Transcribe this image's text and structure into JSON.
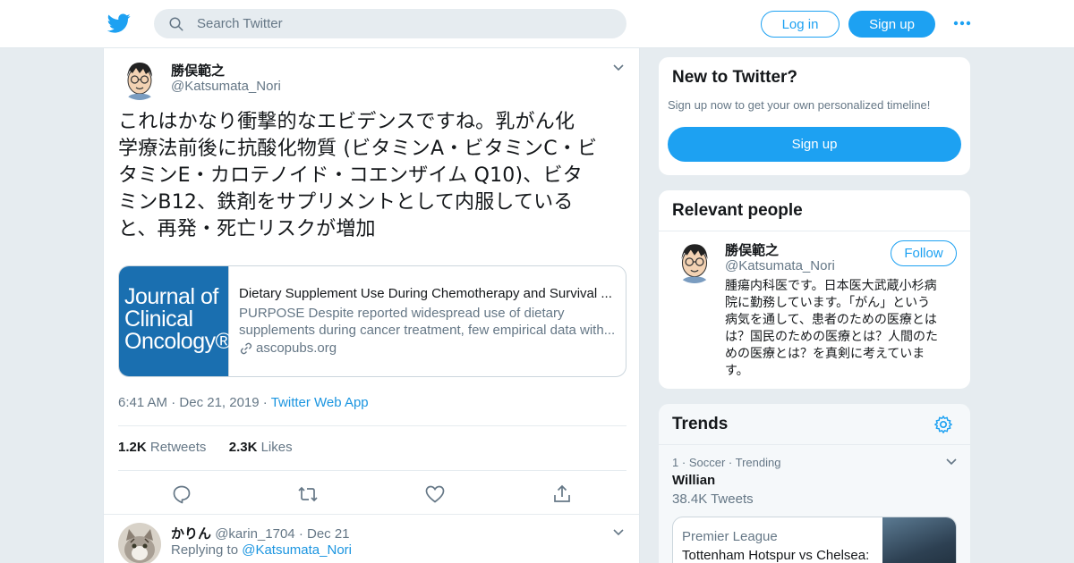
{
  "header": {
    "search_placeholder": "Search Twitter",
    "login_label": "Log in",
    "signup_label": "Sign up",
    "brand_color": "#1da1f2"
  },
  "tweet": {
    "name": "勝俣範之",
    "handle": "@Katsumata_Nori",
    "text_lines": [
      "これはかなり衝撃的なエビデンスですね。乳がん化",
      "学療法前後に抗酸化物質 (ビタミンA・ビタミンC・ビ",
      "タミンE・カロテノイド・コエンザイム Q10)、ビタ",
      "ミンB12、鉄剤をサプリメントとして内服している",
      "と、再発・死亡リスクが増加"
    ],
    "card": {
      "logo_lines": [
        "Journal of",
        "Clinical",
        "Oncology®"
      ],
      "title": "Dietary Supplement Use During Chemotherapy and Survival ...",
      "description_lines": [
        "PURPOSE Despite reported widespread use of dietary",
        "supplements during cancer treatment, few empirical data with..."
      ],
      "domain": "ascopubs.org"
    },
    "time": "6:41 AM",
    "date": "Dec 21, 2019",
    "source": "Twitter Web App",
    "retweets_count": "1.2K",
    "retweets_label": "Retweets",
    "likes_count": "2.3K",
    "likes_label": "Likes"
  },
  "reply": {
    "name": "かりん",
    "handle": "@karin_1704",
    "date": "Dec 21",
    "replying_prefix": "Replying to",
    "replying_to": "@Katsumata_Nori"
  },
  "sidebar": {
    "new_title": "New to Twitter?",
    "new_subtitle": "Sign up now to get your own personalized timeline!",
    "new_button": "Sign up",
    "relevant_title": "Relevant people",
    "person": {
      "name": "勝俣範之",
      "handle": "@Katsumata_Nori",
      "follow_label": "Follow",
      "bio_lines": [
        "腫瘍内科医です。日本医大武蔵小杉病",
        "院に勤務しています。「がん」という",
        "病気を通して、患者のための医療とは",
        "は？国民のための医療とは？人間のた",
        "めの医療とは？を真剣に考えていま",
        "す。"
      ]
    },
    "trends_title": "Trends",
    "trend": {
      "rank": "1",
      "category": "Soccer",
      "status": "Trending",
      "name": "Willian",
      "count": "38.4K Tweets",
      "card_league": "Premier League",
      "card_title": "Tottenham Hotspur vs Chelsea:"
    }
  }
}
